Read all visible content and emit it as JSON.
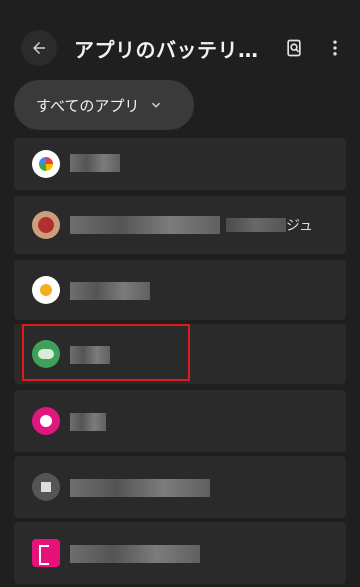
{
  "header": {
    "title": "アプリのバッテリ…"
  },
  "filter": {
    "label": "すべてのアプリ"
  },
  "apps": [
    {
      "name": ""
    },
    {
      "name": "ジュ"
    },
    {
      "name": ""
    },
    {
      "name": ""
    },
    {
      "name": ""
    },
    {
      "name": ""
    },
    {
      "name": ""
    }
  ],
  "colors": {
    "background": "#1f1f1f",
    "row": "#2a2a2a",
    "highlight": "#e01a1a"
  },
  "icons": [
    "back-arrow-icon",
    "search-document-icon",
    "more-vert-icon",
    "chevron-down-icon"
  ]
}
